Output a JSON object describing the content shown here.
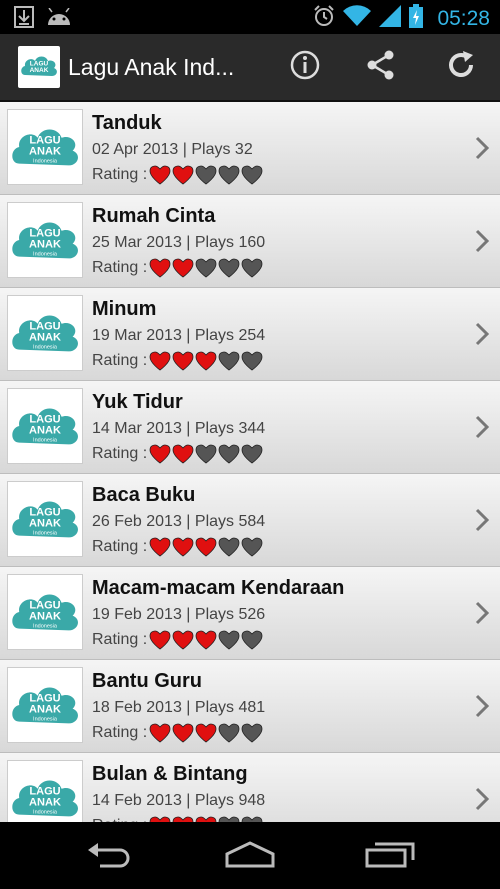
{
  "status_bar": {
    "time": "05:28",
    "icons": [
      "download-icon",
      "android-icon",
      "alarm-icon",
      "wifi-icon",
      "signal-icon",
      "battery-charging-icon"
    ]
  },
  "action_bar": {
    "title": "Lagu Anak Ind...",
    "icons": [
      "info-icon",
      "share-icon",
      "refresh-icon"
    ]
  },
  "logo": {
    "line1": "LAGU",
    "line2": "ANAK",
    "line3": "Indonesia",
    "color": "#3aa9a8"
  },
  "colors": {
    "heart_filled": "#e01010",
    "heart_empty": "#555555",
    "accent": "#33b5e5"
  },
  "rating_label": "Rating :",
  "songs": [
    {
      "title": "Tanduk",
      "meta": "02 Apr 2013 | Plays 32",
      "rating": 2
    },
    {
      "title": "Rumah Cinta",
      "meta": "25 Mar 2013 | Plays 160",
      "rating": 2
    },
    {
      "title": "Minum",
      "meta": "19 Mar 2013 | Plays 254",
      "rating": 3
    },
    {
      "title": "Yuk Tidur",
      "meta": "14 Mar 2013 | Plays 344",
      "rating": 2
    },
    {
      "title": "Baca Buku",
      "meta": "26 Feb 2013 | Plays 584",
      "rating": 3
    },
    {
      "title": "Macam-macam Kendaraan",
      "meta": "19 Feb 2013 | Plays 526",
      "rating": 3
    },
    {
      "title": "Bantu Guru",
      "meta": "18 Feb 2013 | Plays 481",
      "rating": 3
    },
    {
      "title": "Bulan & Bintang",
      "meta": "14 Feb 2013 | Plays 948",
      "rating": 3
    }
  ],
  "max_rating": 5,
  "nav_bar": {
    "icons": [
      "back-icon",
      "home-icon",
      "recent-apps-icon"
    ]
  }
}
